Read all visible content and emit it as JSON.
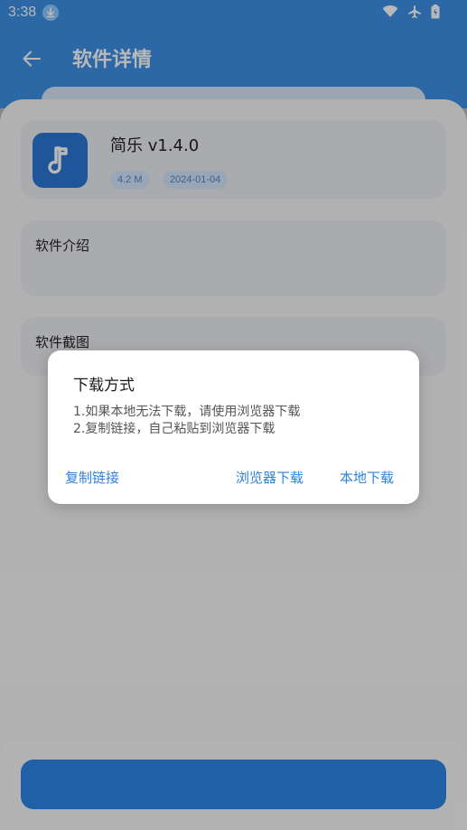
{
  "status_bar": {
    "time": "3:38",
    "icons": [
      "download-badge-icon",
      "wifi-icon",
      "airplane-mode-icon",
      "battery-charging-icon"
    ]
  },
  "app_bar": {
    "title": "软件详情",
    "back_icon": "arrow-left-icon"
  },
  "app_card": {
    "name": "简乐 v1.4.0",
    "icon": "music-note-icon",
    "size": "4.2 M",
    "date": "2024-01-04"
  },
  "intro_card": {
    "label": "软件介绍"
  },
  "screenshots_card": {
    "label": "软件截图"
  },
  "dialog": {
    "title": "下载方式",
    "line1": "1.如果本地无法下载，请使用浏览器下载",
    "line2": "2.复制链接，自己粘贴到浏览器下载",
    "copy_button": "复制链接",
    "browser_button": "浏览器下载",
    "local_button": "本地下载"
  },
  "colors": {
    "primary": "#3d8fe6",
    "accent_text": "#2f83d9",
    "scrim": "rgba(0,0,0,0.28)"
  }
}
